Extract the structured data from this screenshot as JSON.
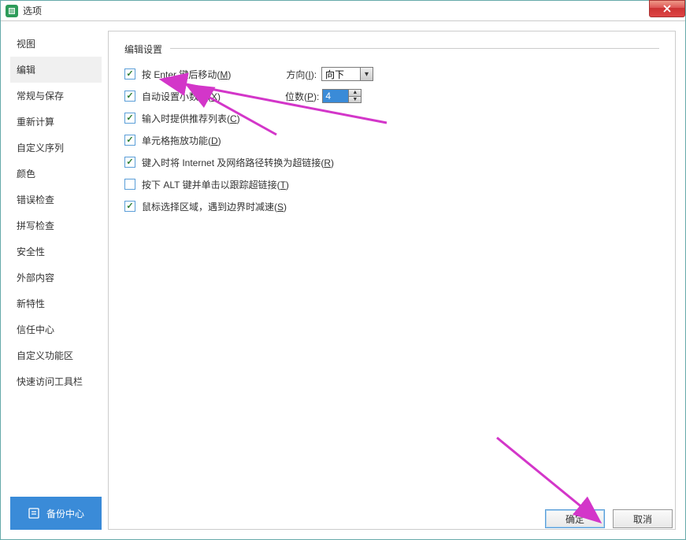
{
  "title": "选项",
  "sidebar": {
    "items": [
      {
        "label": "视图"
      },
      {
        "label": "编辑"
      },
      {
        "label": "常规与保存"
      },
      {
        "label": "重新计算"
      },
      {
        "label": "自定义序列"
      },
      {
        "label": "颜色"
      },
      {
        "label": "错误检查"
      },
      {
        "label": "拼写检查"
      },
      {
        "label": "安全性"
      },
      {
        "label": "外部内容"
      },
      {
        "label": "新特性"
      },
      {
        "label": "信任中心"
      },
      {
        "label": "自定义功能区"
      },
      {
        "label": "快速访问工具栏"
      }
    ],
    "active_index": 1,
    "backup_label": "备份中心"
  },
  "panel": {
    "legend": "编辑设置",
    "opts": {
      "enter_move": {
        "label": "按 Enter 键后移动(",
        "mnemonic": "M",
        "suffix": ")",
        "checked": true
      },
      "direction_label": "方向(",
      "direction_mn": "I",
      "direction_suffix": "):",
      "direction_value": "向下",
      "auto_decimal": {
        "label": "自动设置小数点(",
        "mnemonic": "X",
        "suffix": ")",
        "checked": true
      },
      "places_label": "位数(",
      "places_mn": "P",
      "places_suffix": "):",
      "places_value": "4",
      "suggest_list": {
        "label": "输入时提供推荐列表(",
        "mnemonic": "C",
        "suffix": ")",
        "checked": true
      },
      "drag_fill": {
        "label": "单元格拖放功能(",
        "mnemonic": "D",
        "suffix": ")",
        "checked": true
      },
      "auto_hyperlink": {
        "label": "键入时将 Internet 及网络路径转换为超链接(",
        "mnemonic": "R",
        "suffix": ")",
        "checked": true
      },
      "alt_click_link": {
        "label": "按下 ALT 键并单击以跟踪超链接(",
        "mnemonic": "T",
        "suffix": ")",
        "checked": false
      },
      "slow_at_edge": {
        "label": "鼠标选择区域，遇到边界时减速(",
        "mnemonic": "S",
        "suffix": ")",
        "checked": true
      }
    }
  },
  "buttons": {
    "ok": "确定",
    "cancel": "取消"
  }
}
